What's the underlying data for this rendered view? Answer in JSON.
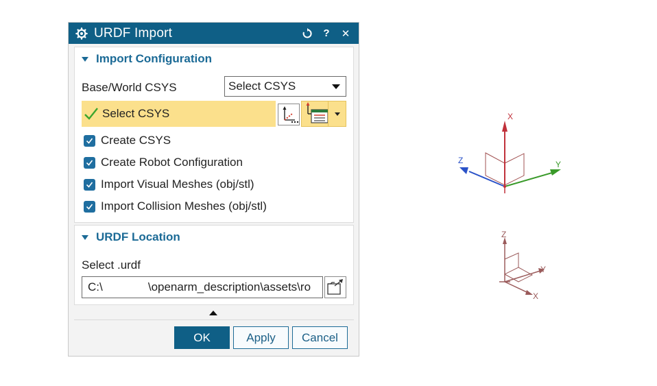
{
  "dialog": {
    "title": "URDF Import",
    "title_icon": "gear-icon",
    "titlebar_buttons": [
      "reset-icon",
      "help-icon",
      "close-icon"
    ],
    "help_label": "?",
    "close_label": "✕"
  },
  "import_config": {
    "header": "Import Configuration",
    "base_label": "Base/World CSYS",
    "select_value": "Select CSYS",
    "select_bar_label": "Select CSYS",
    "checkboxes": [
      {
        "label": "Create CSYS",
        "checked": true
      },
      {
        "label": "Create Robot Configuration",
        "checked": true
      },
      {
        "label": "Import Visual Meshes (obj/stl)",
        "checked": true
      },
      {
        "label": "Import Collision Meshes (obj/stl)",
        "checked": true
      }
    ]
  },
  "urdf_location": {
    "header": "URDF Location",
    "select_label": "Select .urdf",
    "path_value": "C:\\              \\openarm_description\\assets\\ro"
  },
  "buttons": {
    "ok": "OK",
    "apply": "Apply",
    "cancel": "Cancel"
  },
  "viewport": {
    "triad1": {
      "x": "X",
      "y": "Y",
      "z": "Z"
    },
    "triad2": {
      "x": "X",
      "y": "Y",
      "z": "Z"
    },
    "colors": {
      "x_axis": "#c0303a",
      "y_axis": "#3a9a2a",
      "z_axis": "#2a52c8",
      "secondary": "#9a5a5a"
    }
  }
}
